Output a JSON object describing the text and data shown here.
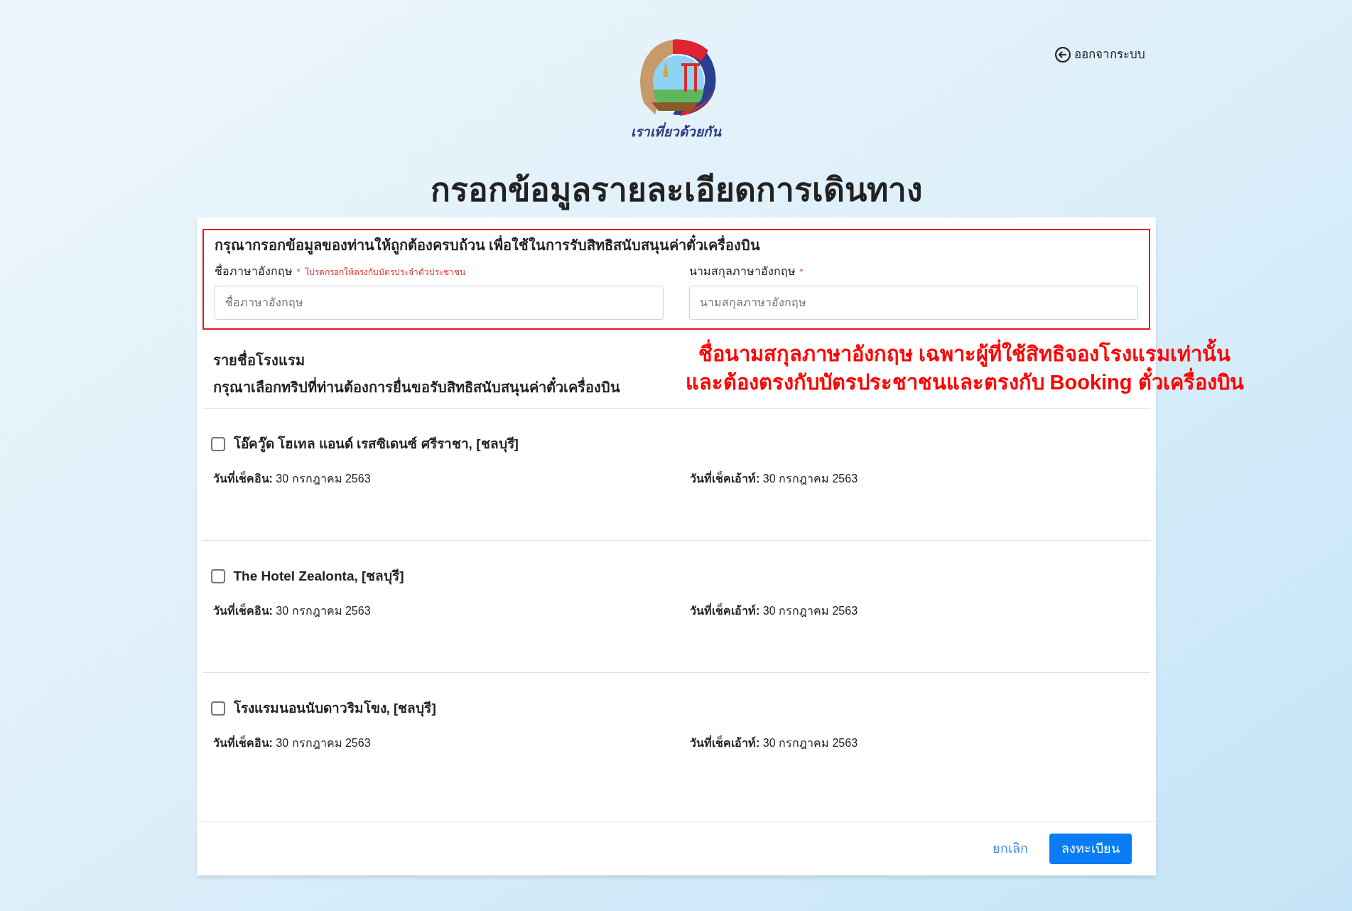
{
  "logo": {
    "caption": "เราเที่ยวด้วยกัน"
  },
  "logout": {
    "label": "ออกจากระบบ"
  },
  "title": "กรอกข้อมูลรายละเอียดการเดินทาง",
  "form": {
    "instruction": "กรุณากรอกข้อมูลของท่านให้ถูกต้องครบถ้วน เพื่อใช้ในการรับสิทธิสนับสนุนค่าตั๋วเครื่องบิน",
    "fields": [
      {
        "label": "ชื่อภาษาอังกฤษ",
        "required_mark": "*",
        "hint": "โปรดกรอกให้ตรงกับบัตรประจำตัวประชาชน",
        "placeholder": "ชื่อภาษาอังกฤษ"
      },
      {
        "label": "นามสกุลภาษาอังกฤษ",
        "required_mark": "*",
        "placeholder": "นามสกุลภาษาอังกฤษ"
      }
    ]
  },
  "annotation": [
    "ชื่อนามสกุลภาษาอังกฤษ เฉพาะผู้ที่ใช้สิทธิจองโรงแรมเท่านั้น",
    "และต้องตรงกับบัตรประชาชนและตรงกับ Booking ตั๋วเครื่องบิน"
  ],
  "hotels_heading": "รายชื่อโรงแรม",
  "hotels_instruction": "กรุณาเลือกทริปที่ท่านต้องการยื่นขอรับสิทธิสนับสนุนค่าตั๋วเครื่องบิน",
  "hotels": [
    {
      "name": "โอ๊ควู๊ด โฮเทล แอนด์ เรสซิเดนซ์ ศรีราชา, [ชลบุรี]",
      "checked": false,
      "check_in": "**วันที่เช็คอิน:** 30 กรกฎาคม 2563",
      "check_out": "**วันที่เช็คเอ้าท์:** 30 กรกฎาคม 2563"
    },
    {
      "name": "The Hotel Zealonta, [ชลบุรี]",
      "checked": false,
      "check_in": "**วันที่เช็คอิน:** 30 กรกฎาคม 2563",
      "check_out": "**วันที่เช็คเอ้าท์:** 30 กรกฎาคม 2563"
    },
    {
      "name": "โรงแรมนอนนับดาวริมโขง, [ชลบุรี]",
      "checked": false,
      "check_in": "**วันที่เช็คอิน:** 30 กรกฎาคม 2563",
      "check_out": "**วันที่เช็คเอ้าท์:** 30 กรกฎาคม 2563"
    }
  ],
  "buttons": [
    {
      "label": "ยกเลิก",
      "kind": "link"
    },
    {
      "label": "ลงทะเบียน",
      "kind": "primary"
    }
  ]
}
